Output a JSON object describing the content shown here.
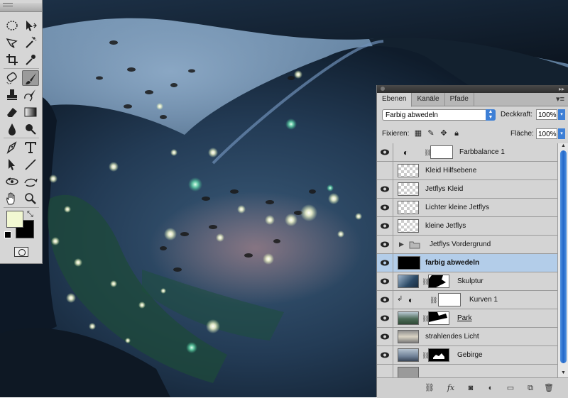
{
  "colors": {
    "foreground": "#f2f8d2",
    "background": "#000000",
    "selection": "#b3cde9",
    "accent": "#3d7fd6"
  },
  "tools": {
    "items": [
      "marquee-icon",
      "move-icon",
      "lasso-icon",
      "magic-wand-icon",
      "crop-icon",
      "eyedropper-icon",
      "spot-healing-icon",
      "brush-icon",
      "stamp-icon",
      "history-brush-icon",
      "eraser-icon",
      "gradient-icon",
      "blur-icon",
      "dodge-icon",
      "pen-icon",
      "type-icon",
      "path-select-icon",
      "line-icon",
      "3d-rotate-icon",
      "3d-orbit-icon",
      "hand-icon",
      "zoom-icon"
    ],
    "active": "brush-icon"
  },
  "layers_panel": {
    "tabs": [
      {
        "label": "Ebenen",
        "active": true
      },
      {
        "label": "Kanäle",
        "active": false
      },
      {
        "label": "Pfade",
        "active": false
      }
    ],
    "blend_mode": "Farbig abwedeln",
    "opacity_label": "Deckkraft:",
    "opacity_value": "100%",
    "lock_label": "Fixieren:",
    "fill_label": "Fläche:",
    "fill_value": "100%",
    "layers": [
      {
        "name": "Farbbalance 1",
        "visible": true,
        "kind": "adjustment",
        "selected": false
      },
      {
        "name": "Kleid Hilfsebene",
        "visible": false,
        "kind": "transparent",
        "selected": false
      },
      {
        "name": "Jetflys Kleid",
        "visible": true,
        "kind": "transparent",
        "selected": false
      },
      {
        "name": "Lichter kleine Jetflys",
        "visible": true,
        "kind": "transparent",
        "selected": false
      },
      {
        "name": "kleine Jetflys",
        "visible": true,
        "kind": "transparent",
        "selected": false
      },
      {
        "name": "Jetflys Vordergrund",
        "visible": true,
        "kind": "group",
        "selected": false
      },
      {
        "name": "farbig abwedeln",
        "visible": true,
        "kind": "black",
        "selected": true
      },
      {
        "name": "Skulptur",
        "visible": true,
        "kind": "masked",
        "selected": false
      },
      {
        "name": "Kurven 1",
        "visible": true,
        "kind": "adjustment-clipped",
        "selected": false
      },
      {
        "name": "Park",
        "visible": true,
        "kind": "masked",
        "selected": false
      },
      {
        "name": "strahlendes Licht",
        "visible": true,
        "kind": "photo",
        "selected": false
      },
      {
        "name": "Gebirge",
        "visible": true,
        "kind": "masked",
        "selected": false
      }
    ],
    "footer_icons": [
      "link-icon",
      "fx-icon",
      "mask-icon",
      "adjustment-icon",
      "folder-icon",
      "new-layer-icon",
      "trash-icon"
    ]
  }
}
